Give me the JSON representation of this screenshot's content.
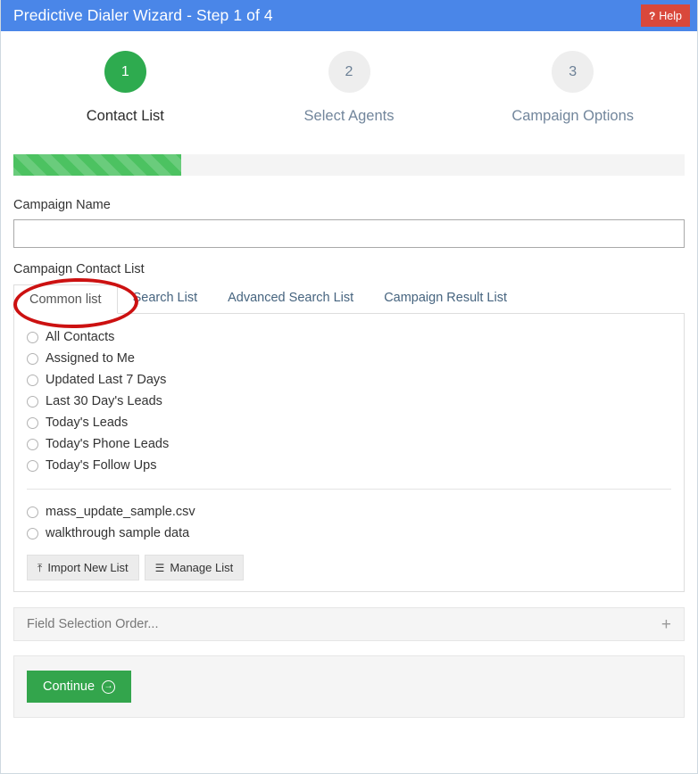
{
  "titlebar": {
    "title": "Predictive Dialer Wizard - Step 1 of 4",
    "help_label": "Help",
    "help_icon": "question-mark-icon",
    "bg_color": "#4a86e8",
    "help_bg_color": "#d9483b"
  },
  "steps": [
    {
      "number": "1",
      "label": "Contact List",
      "state": "active"
    },
    {
      "number": "2",
      "label": "Select Agents",
      "state": "inactive"
    },
    {
      "number": "3",
      "label": "Campaign Options",
      "state": "inactive"
    }
  ],
  "progress": {
    "percent": 25,
    "fill_color": "#4cc261",
    "track_color": "#f4f4f4"
  },
  "campaign_name": {
    "label": "Campaign Name",
    "value": "",
    "placeholder": ""
  },
  "contact_list": {
    "section_label": "Campaign Contact List",
    "tabs": [
      {
        "label": "Common list",
        "active": true
      },
      {
        "label": "Search List",
        "active": false
      },
      {
        "label": "Advanced Search List",
        "active": false
      },
      {
        "label": "Campaign Result List",
        "active": false
      }
    ],
    "annotation": {
      "shape": "ellipse",
      "color": "#cc1111",
      "targets": "Common list"
    },
    "primary_options": [
      {
        "label": "All Contacts",
        "selected": false
      },
      {
        "label": "Assigned to Me",
        "selected": false
      },
      {
        "label": "Updated Last 7 Days",
        "selected": false
      },
      {
        "label": "Last 30 Day's Leads",
        "selected": false
      },
      {
        "label": "Today's Leads",
        "selected": false
      },
      {
        "label": "Today's Phone Leads",
        "selected": false
      },
      {
        "label": "Today's Follow Ups",
        "selected": false
      }
    ],
    "imported_lists": [
      {
        "label": "mass_update_sample.csv",
        "selected": false
      },
      {
        "label": "walkthrough sample data",
        "selected": false
      }
    ],
    "actions": [
      {
        "label": "Import New List",
        "icon": "upload-icon",
        "glyph": "⤒"
      },
      {
        "label": "Manage List",
        "icon": "hamburger-icon",
        "glyph": "☰"
      }
    ]
  },
  "field_selection": {
    "title": "Field Selection Order...",
    "expand_icon": "plus-icon",
    "expand_glyph": "+"
  },
  "footer": {
    "continue_label": "Continue",
    "continue_icon": "arrow-right-circle-icon",
    "continue_glyph": "→",
    "continue_color": "#33a54c"
  }
}
